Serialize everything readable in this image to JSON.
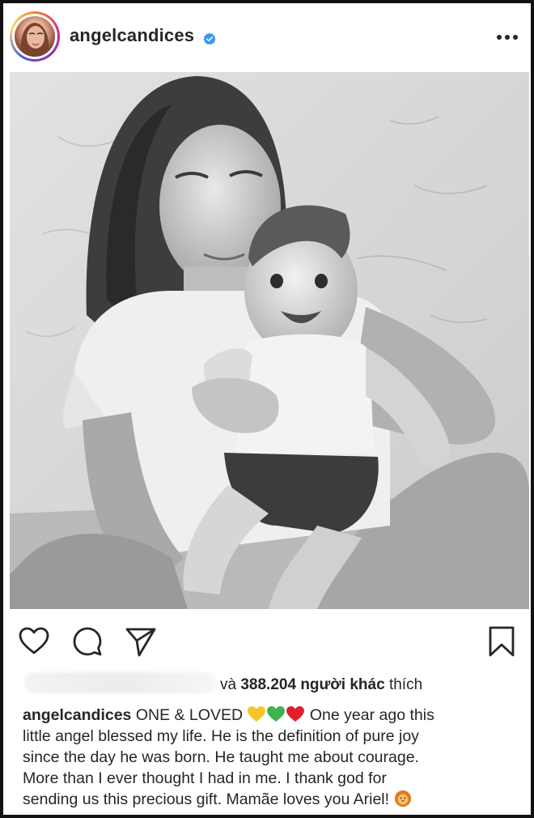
{
  "post": {
    "username": "angelcandices",
    "verified": true,
    "likes": {
      "prefix": "và",
      "count": "388.204",
      "others_label": "người khác",
      "suffix": "thích"
    },
    "caption": {
      "username": "angelcandices",
      "title": "ONE & LOVED",
      "hearts": [
        "yellow-heart",
        "green-heart",
        "red-heart"
      ],
      "line1_tail": "One year ago this",
      "line2": "little angel blessed my life. He is the definition of pure joy",
      "line3": "since the day he was born. He taught me about courage.",
      "line4": "More than I ever thought I had in me. I thank god for",
      "line5": "sending us this precious gift. Mamãe loves you Ariel!",
      "end_emoji": "lion-face"
    }
  },
  "icons": {
    "like": "heart-outline-icon",
    "comment": "comment-bubble-icon",
    "share": "paper-plane-icon",
    "save": "bookmark-icon",
    "more": "ellipsis-icon",
    "verified": "verified-badge-icon"
  },
  "colors": {
    "verified_blue": "#3897f0",
    "text": "#262626",
    "heart_yellow": "#f7c52b",
    "heart_green": "#3cb44b",
    "heart_red": "#e0202e"
  }
}
